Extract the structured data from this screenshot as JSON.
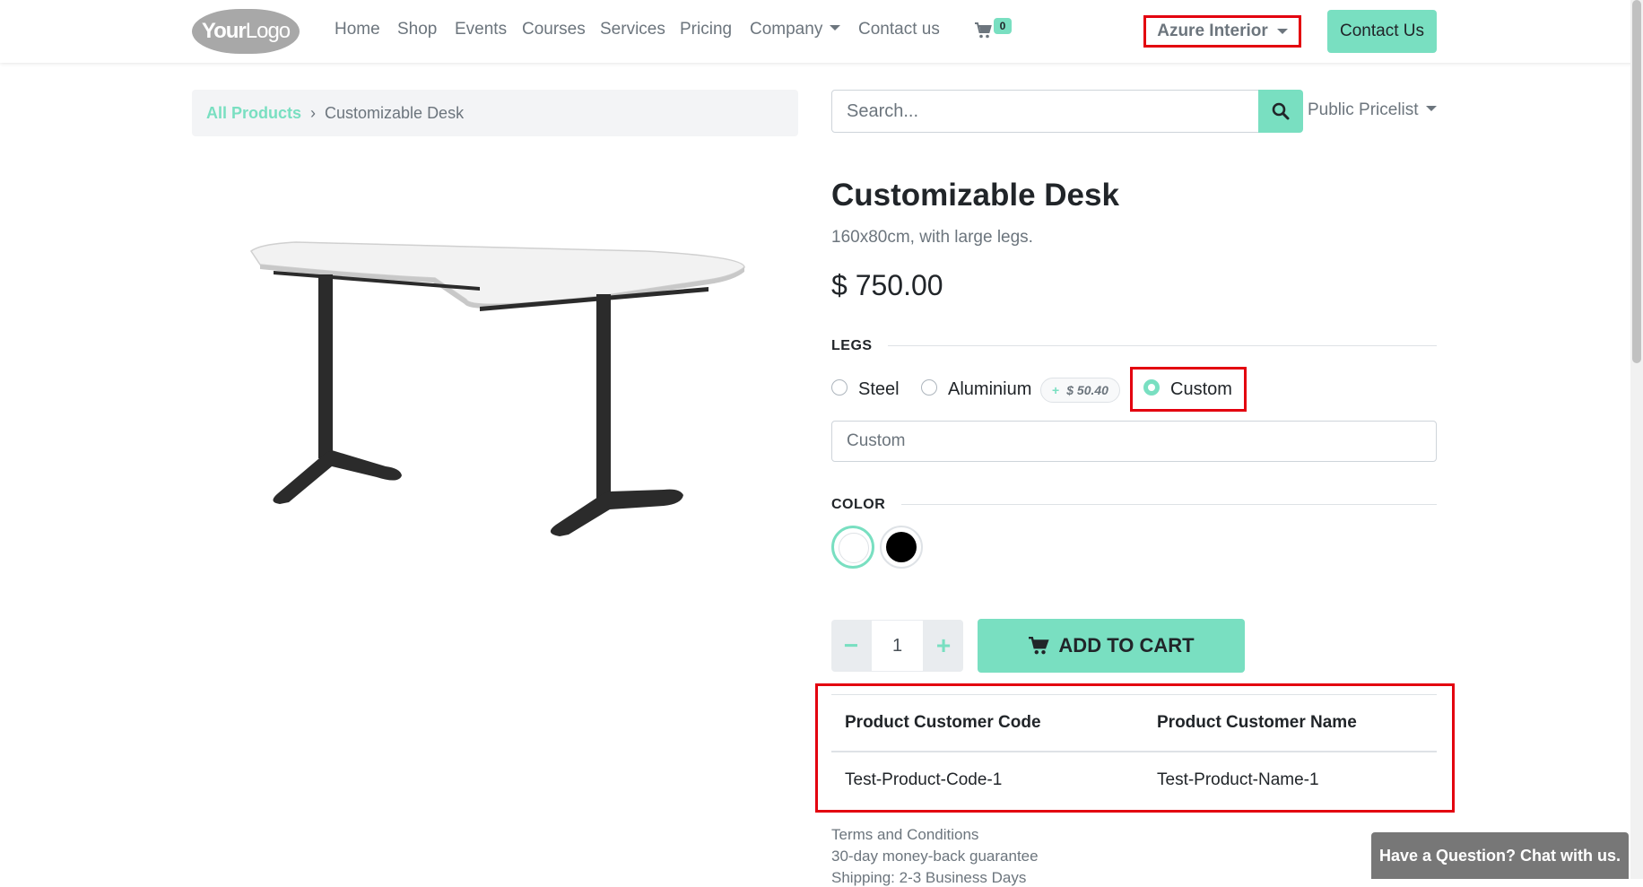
{
  "header": {
    "logo": {
      "bold": "Your",
      "light": "Logo"
    },
    "nav": [
      "Home",
      "Shop",
      "Events",
      "Courses",
      "Services",
      "Pricing",
      "Company",
      "Contact us"
    ],
    "cart_count": "0",
    "user_menu": "Azure Interior",
    "contact_button": "Contact Us"
  },
  "breadcrumb": {
    "link": "All Products",
    "separator": "›",
    "current": "Customizable Desk"
  },
  "search": {
    "placeholder": "Search...",
    "pricelist": "Public Pricelist"
  },
  "product": {
    "name": "Customizable Desk",
    "description": "160x80cm, with large legs.",
    "price": "$ 750.00",
    "legs": {
      "label": "LEGS",
      "options": [
        "Steel",
        "Aluminium",
        "Custom"
      ],
      "selected": "Custom",
      "aluminium_extra": "$ 50.40",
      "extra_prefix": "+",
      "custom_placeholder": "Custom"
    },
    "color": {
      "label": "COLOR",
      "options": [
        "white",
        "black"
      ],
      "selected": "white"
    },
    "quantity": "1",
    "minus": "−",
    "plus": "+",
    "add_to_cart": "ADD TO CART"
  },
  "customer_table": {
    "headers": [
      "Product Customer Code",
      "Product Customer Name"
    ],
    "row": [
      "Test-Product-Code-1",
      "Test-Product-Name-1"
    ]
  },
  "terms": [
    "Terms and Conditions",
    "30-day money-back guarantee",
    "Shipping: 2-3 Business Days"
  ],
  "chat": "Have a Question? Chat with us.",
  "colors": {
    "accent": "#79dfc1",
    "highlight": "#e3000f",
    "muted": "#6c757d"
  }
}
